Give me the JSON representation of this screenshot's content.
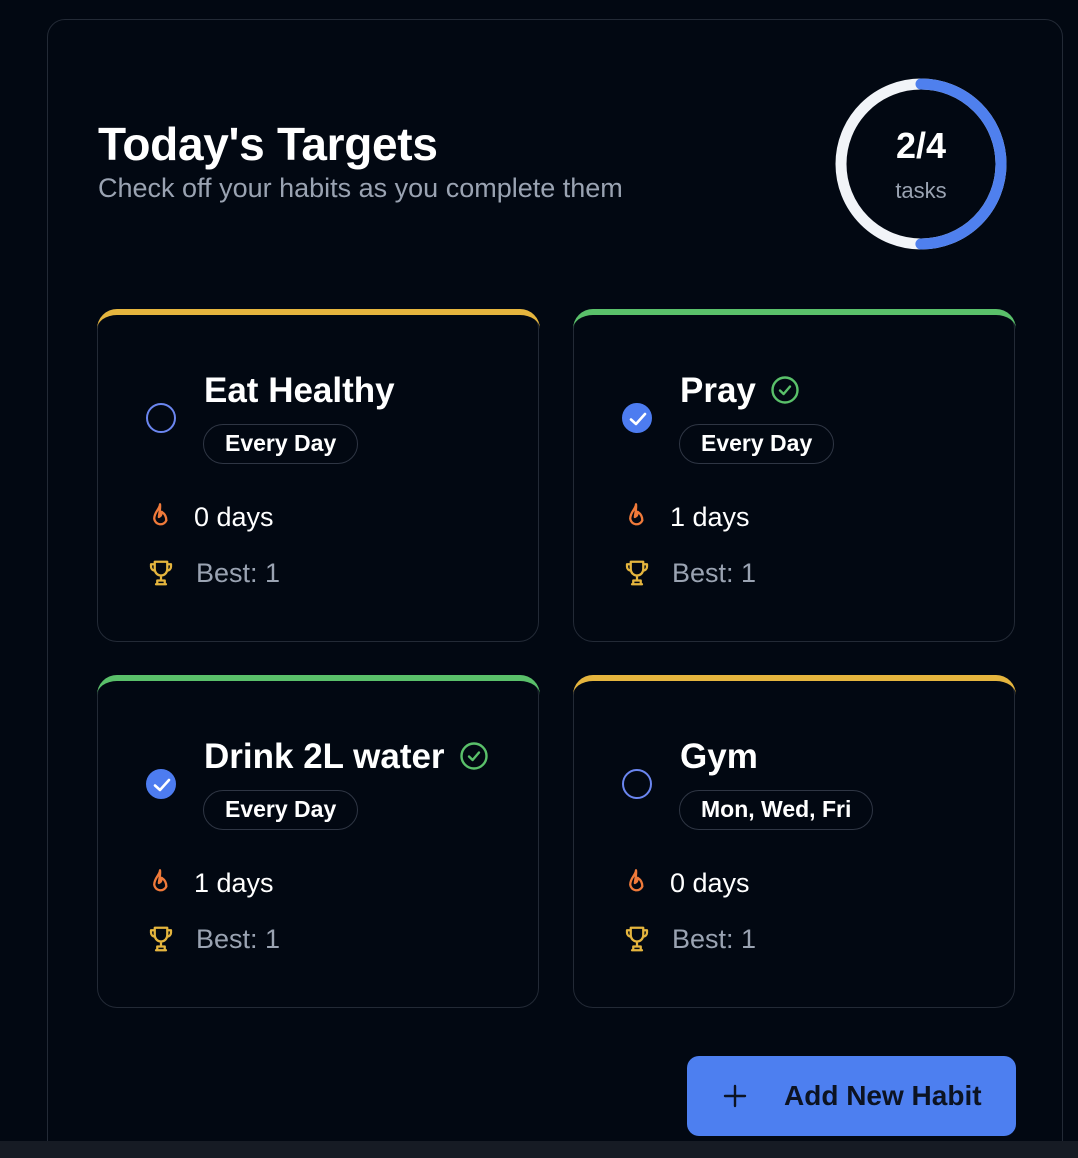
{
  "header": {
    "title": "Today's Targets",
    "subtitle": "Check off your habits as you complete them"
  },
  "progress": {
    "completed": 2,
    "total": 4,
    "count_label": "2/4",
    "unit_label": "tasks",
    "track_color": "#f1f4f8",
    "fill_color": "#4f80ee"
  },
  "habits": [
    {
      "name": "Eat Healthy",
      "frequency": "Every Day",
      "completed": false,
      "streak": "0 days",
      "best": "Best: 1",
      "accent_color": "#e5b53e"
    },
    {
      "name": "Pray",
      "frequency": "Every Day",
      "completed": true,
      "streak": "1 days",
      "best": "Best: 1",
      "accent_color": "#5ac06a"
    },
    {
      "name": "Drink 2L water",
      "frequency": "Every Day",
      "completed": true,
      "streak": "1 days",
      "best": "Best: 1",
      "accent_color": "#5ac06a"
    },
    {
      "name": "Gym",
      "frequency": "Mon, Wed, Fri",
      "completed": false,
      "streak": "0 days",
      "best": "Best: 1",
      "accent_color": "#e5b53e"
    }
  ],
  "icons": {
    "streak": "flame-icon",
    "best": "trophy-icon",
    "done": "check-circle-icon",
    "checkbox": "checkmark-icon",
    "add": "plus-icon"
  },
  "colors": {
    "background": "#020812",
    "pending_accent": "#e5b53e",
    "done_accent": "#5ac06a",
    "primary": "#4d7ff0",
    "flame": "#f07a3a",
    "trophy": "#e5b53e"
  },
  "actions": {
    "add_habit_label": "Add New Habit"
  }
}
